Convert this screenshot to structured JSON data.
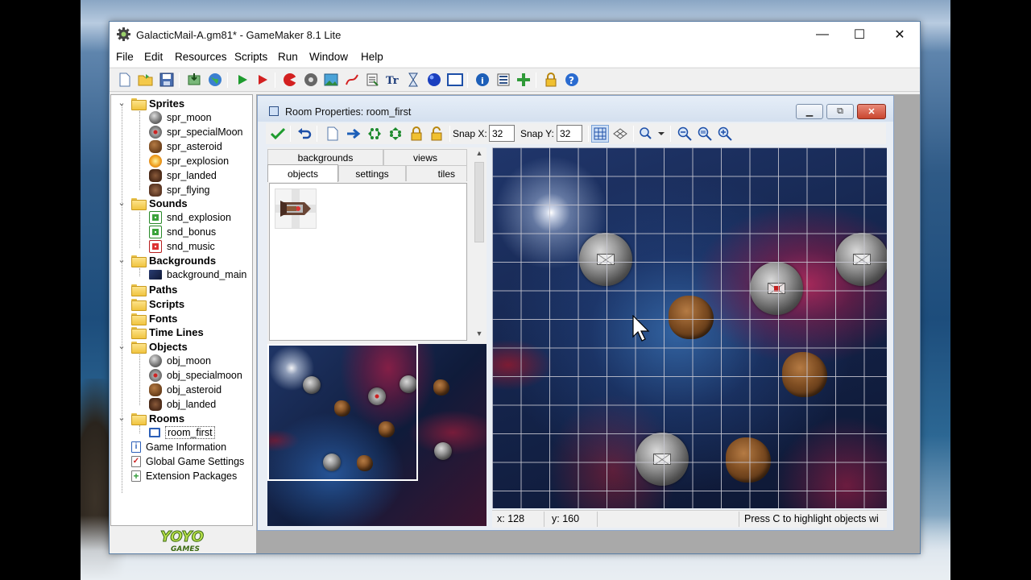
{
  "window": {
    "title": "GalacticMail-A.gm81* - GameMaker 8.1 Lite",
    "minimize_glyph": "—",
    "maximize_glyph": "☐",
    "close_glyph": "✕"
  },
  "menu": [
    "File",
    "Edit",
    "Resources",
    "Scripts",
    "Run",
    "Window",
    "Help"
  ],
  "toolbar_icons": [
    "new-file-icon",
    "open-folder-icon",
    "save-icon",
    "export-icon",
    "globe-icon",
    "run-icon",
    "debug-run-icon",
    "add-sprite-icon",
    "add-sound-icon",
    "add-background-icon",
    "add-path-icon",
    "add-script-icon",
    "add-font-icon",
    "add-timeline-icon",
    "add-object-icon",
    "add-room-icon",
    "game-info-icon",
    "global-settings-icon",
    "extension-packages-icon",
    "lite-lock-icon",
    "help-icon"
  ],
  "tree": {
    "sprites": {
      "label": "Sprites",
      "items": [
        "spr_moon",
        "spr_specialMoon",
        "spr_asteroid",
        "spr_explosion",
        "spr_landed",
        "spr_flying"
      ]
    },
    "sounds": {
      "label": "Sounds",
      "items": [
        "snd_explosion",
        "snd_bonus",
        "snd_music"
      ]
    },
    "backgrounds": {
      "label": "Backgrounds",
      "items": [
        "background_main"
      ]
    },
    "paths": {
      "label": "Paths"
    },
    "scripts": {
      "label": "Scripts"
    },
    "fonts": {
      "label": "Fonts"
    },
    "timelines": {
      "label": "Time Lines"
    },
    "objects": {
      "label": "Objects",
      "items": [
        "obj_moon",
        "obj_specialmoon",
        "obj_asteroid",
        "obj_landed"
      ]
    },
    "rooms": {
      "label": "Rooms",
      "items": [
        "room_first"
      ]
    },
    "extras": [
      "Game Information",
      "Global Game Settings",
      "Extension Packages"
    ]
  },
  "logo": {
    "text_top": "YOYO",
    "text_bottom": "GAMES"
  },
  "room_window": {
    "title": "Room Properties: room_first",
    "snap_x_label": "Snap X:",
    "snap_x_value": "32",
    "snap_y_label": "Snap Y:",
    "snap_y_value": "32",
    "tabs_row1": [
      "backgrounds",
      "views"
    ],
    "tabs_row2": [
      "objects",
      "settings",
      "tiles"
    ],
    "active_tab": "objects"
  },
  "status": {
    "x": "x: 128",
    "y": "y: 160",
    "hint": "Press C to highlight objects wi"
  },
  "colors": {
    "accent": "#2c4f86",
    "close_red": "#c9462f",
    "folder_yellow": "#f0c440",
    "space_dark": "#14244b"
  }
}
